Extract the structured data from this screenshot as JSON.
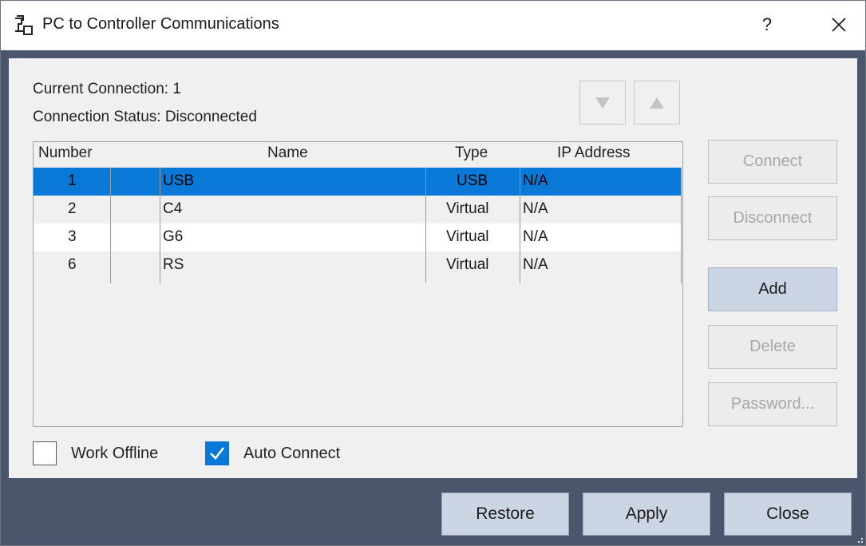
{
  "window": {
    "title": "PC to Controller Communications",
    "help_label": "?",
    "close_icon": "close-icon",
    "app_icon": "connection-icon"
  },
  "status": {
    "current_connection": "Current Connection: 1",
    "connection_status": "Connection Status: Disconnected"
  },
  "reorder": {
    "down_icon": "triangle-down-icon",
    "up_icon": "triangle-up-icon"
  },
  "table": {
    "columns": [
      "Number",
      "Name",
      "Type",
      "IP Address"
    ],
    "rows": [
      {
        "number": "1",
        "name": "USB",
        "type": "USB",
        "ip": "N/A",
        "selected": true
      },
      {
        "number": "2",
        "name": "C4",
        "type": "Virtual",
        "ip": "N/A",
        "selected": false
      },
      {
        "number": "3",
        "name": "G6",
        "type": "Virtual",
        "ip": "N/A",
        "selected": false
      },
      {
        "number": "6",
        "name": "RS",
        "type": "Virtual",
        "ip": "N/A",
        "selected": false
      }
    ]
  },
  "side_buttons": {
    "connect": "Connect",
    "disconnect": "Disconnect",
    "add": "Add",
    "delete": "Delete",
    "password": "Password..."
  },
  "options": {
    "work_offline": {
      "label": "Work Offline",
      "checked": false
    },
    "auto_connect": {
      "label": "Auto Connect",
      "checked": true
    }
  },
  "footer": {
    "restore": "Restore",
    "apply": "Apply",
    "close": "Close"
  },
  "colors": {
    "selection": "#0a78d7",
    "frame": "#4a566b",
    "button_enabled": "#ccd5e4"
  }
}
